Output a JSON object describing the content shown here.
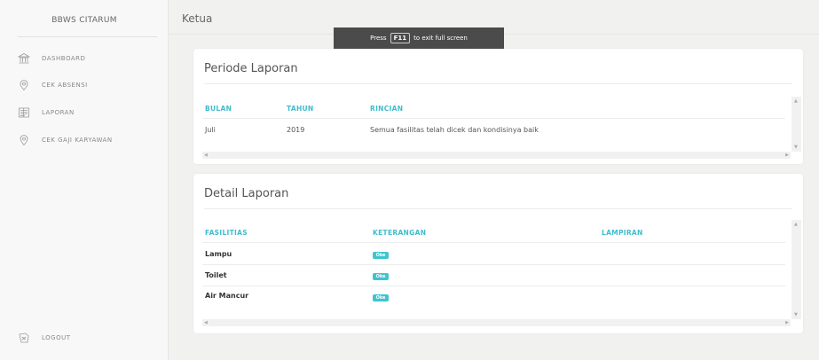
{
  "sidebar": {
    "brand": "BBWS CITARUM",
    "items": [
      {
        "label": "DASHBOARD",
        "icon": "bank-icon"
      },
      {
        "label": "CEK ABSENSI",
        "icon": "location-icon"
      },
      {
        "label": "LAPORAN",
        "icon": "report-icon"
      },
      {
        "label": "CEK GAJI KARYAWAN",
        "icon": "location-icon"
      }
    ],
    "logout": {
      "label": "LOGOUT",
      "icon": "logout-icon"
    }
  },
  "header": {
    "title": "Ketua"
  },
  "fullscreen_notice": {
    "prefix": "Press",
    "key": "F11",
    "suffix": "to exit full screen"
  },
  "periode": {
    "title": "Periode Laporan",
    "columns": [
      "BULAN",
      "TAHUN",
      "RINCIAN"
    ],
    "rows": [
      {
        "bulan": "Juli",
        "tahun": "2019",
        "rincian": "Semua fasilitas telah dicek dan kondisinya baik"
      }
    ]
  },
  "detail": {
    "title": "Detail Laporan",
    "columns": [
      "FASILITIAS",
      "KETERANGAN",
      "LAMPIRAN"
    ],
    "rows": [
      {
        "fasilitas": "Lampu",
        "keterangan": "Oke"
      },
      {
        "fasilitas": "Toilet",
        "keterangan": "Oke"
      },
      {
        "fasilitas": "Air Mancur",
        "keterangan": "Oke"
      }
    ]
  },
  "colors": {
    "accent": "#3fbccb",
    "badge": "#3fc4cf",
    "background": "#f1f1ef"
  }
}
